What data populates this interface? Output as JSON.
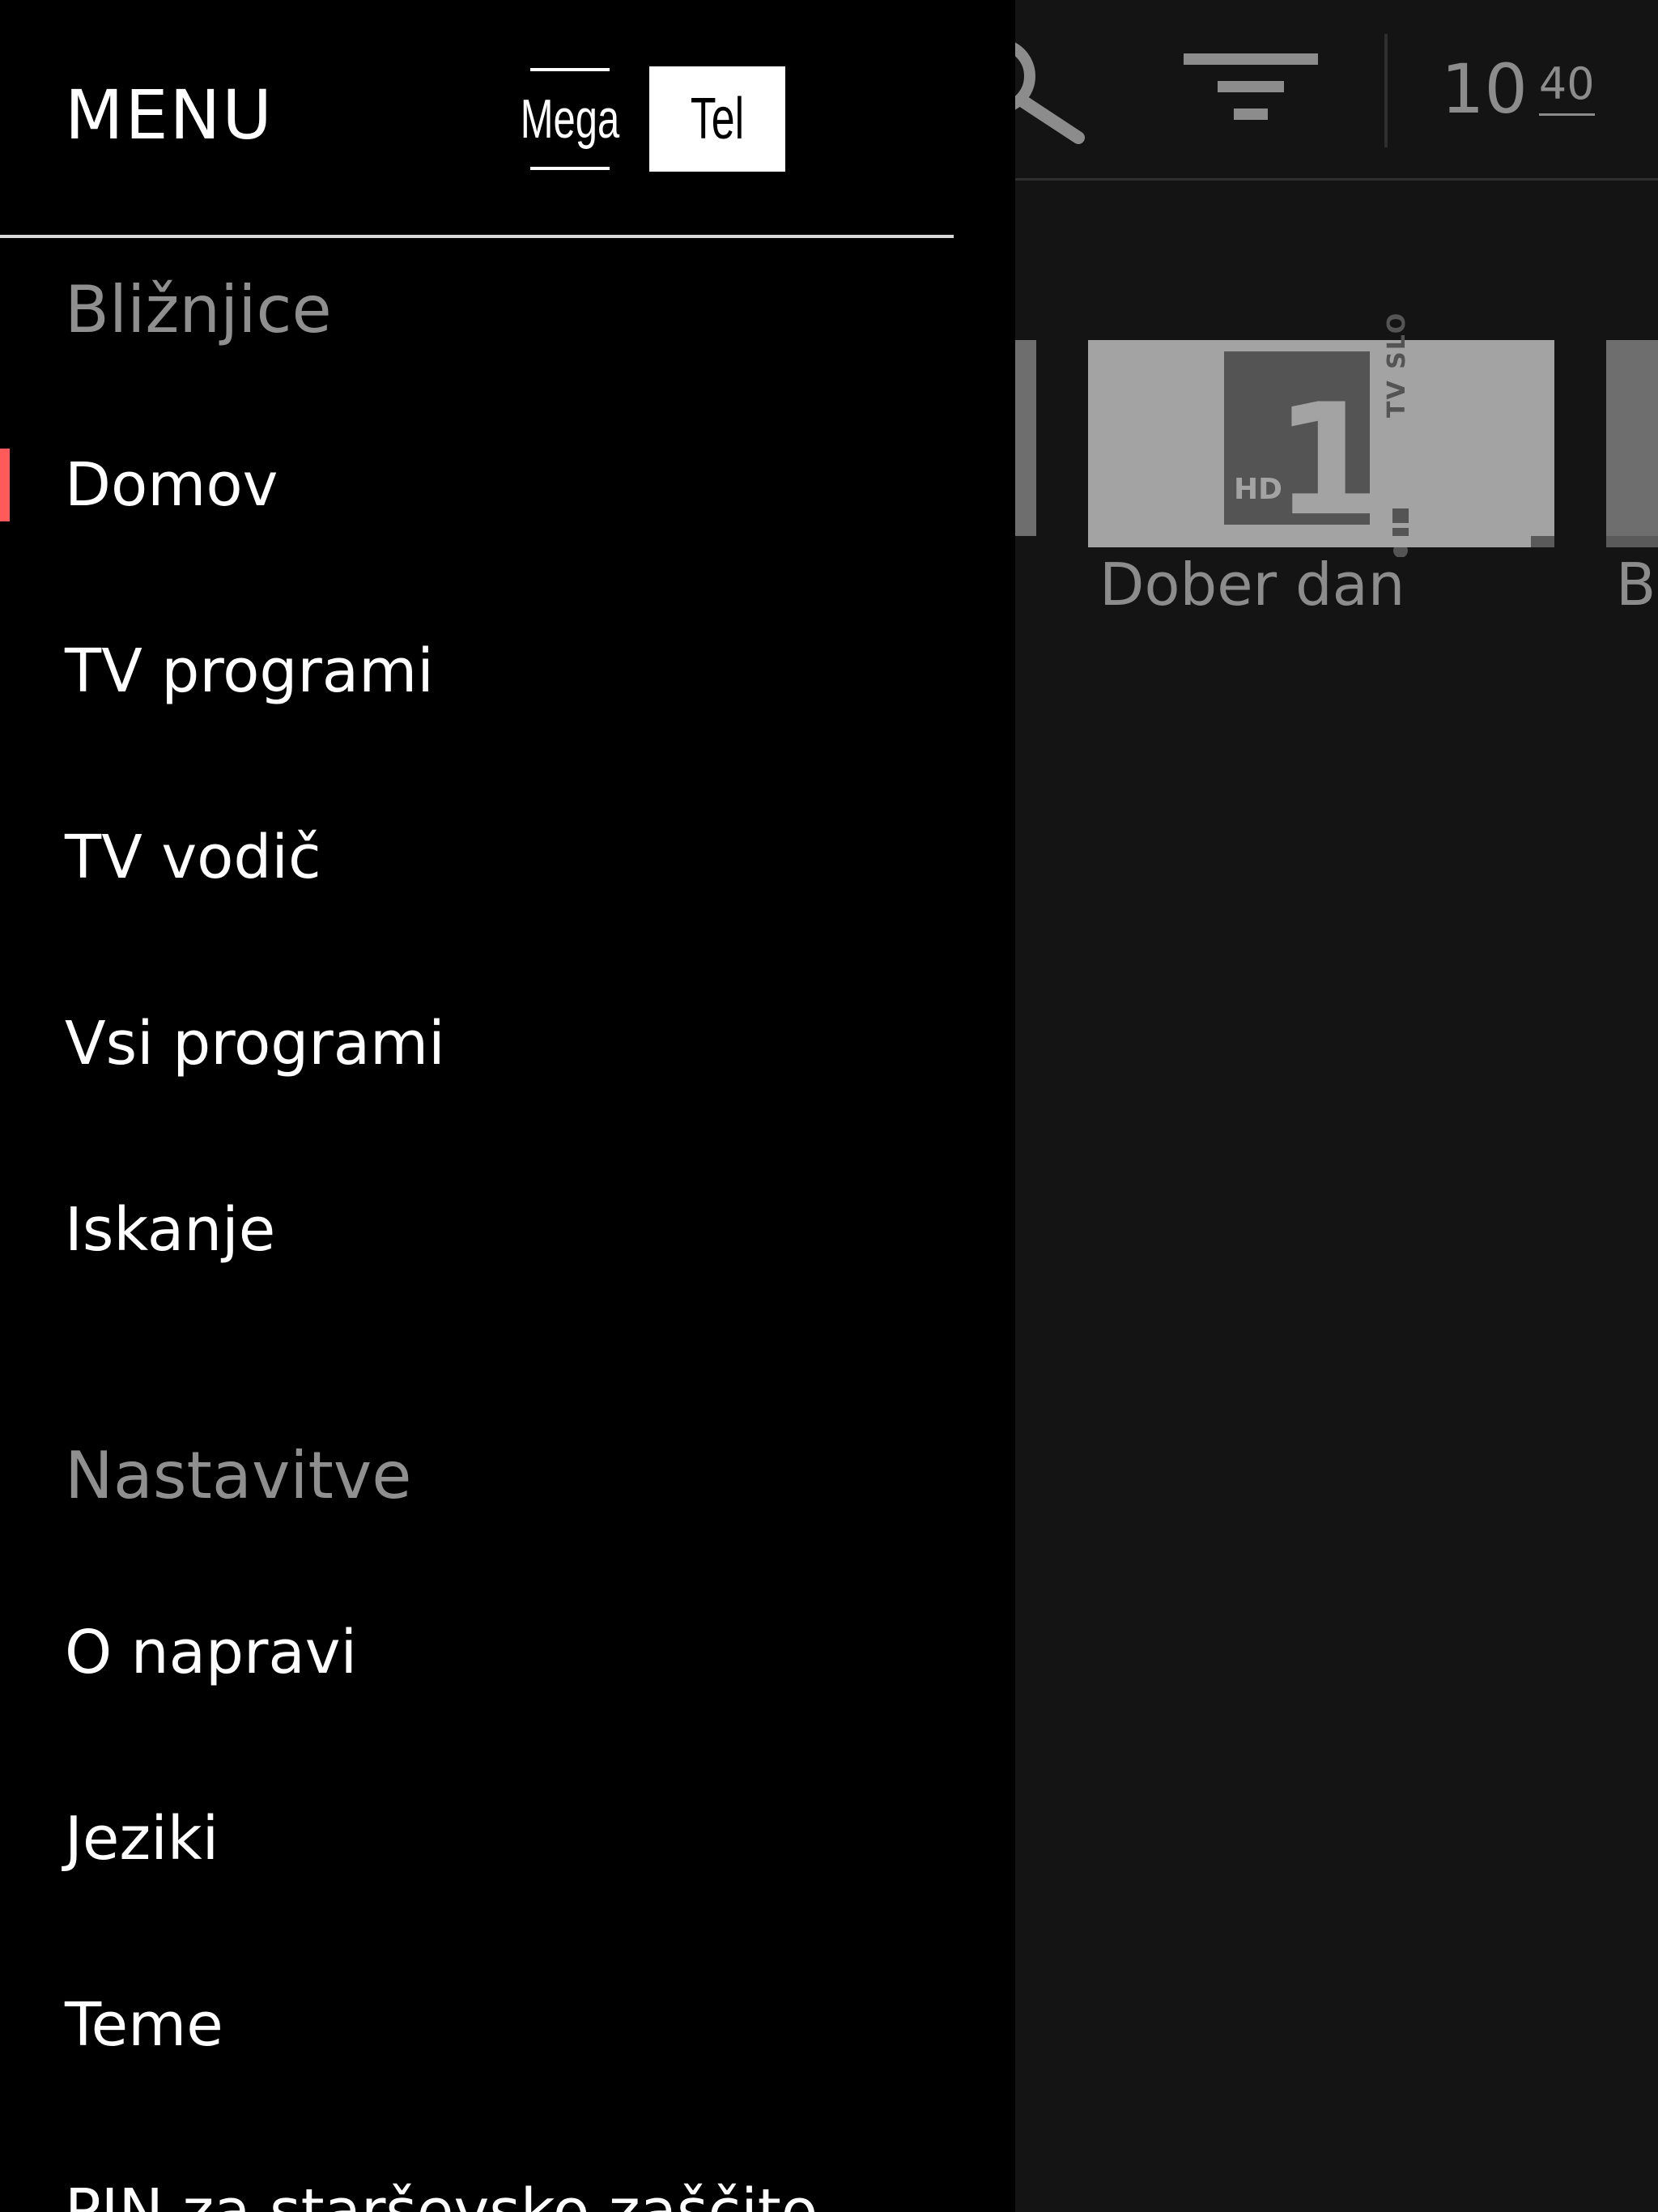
{
  "colors": {
    "active_indicator": "#ff5a5a",
    "drawer_bg": "#000000",
    "screen_bg": "#141414"
  },
  "header": {
    "search_icon": "search-icon",
    "filter_icon": "filter-icon",
    "clock_hours": "10",
    "clock_minutes": "40"
  },
  "content": {
    "tile": {
      "channel_badge": "HD",
      "channel_number": "1",
      "channel_brand": "TV SLO",
      "title": "Dober dan",
      "progress": 0.95
    },
    "next_tile_title": "B"
  },
  "drawer": {
    "title": "MENU",
    "brand": {
      "part1": "Mega",
      "part2": "Tel"
    },
    "sections": [
      {
        "label": "Bližnjice",
        "items": [
          {
            "label": "Domov",
            "active": true
          },
          {
            "label": "TV programi",
            "active": false
          },
          {
            "label": "TV vodič",
            "active": false
          },
          {
            "label": "Vsi programi",
            "active": false
          },
          {
            "label": "Iskanje",
            "active": false
          }
        ]
      },
      {
        "label": "Nastavitve",
        "items": [
          {
            "label": "O napravi",
            "active": false
          },
          {
            "label": "Jeziki",
            "active": false
          },
          {
            "label": "Teme",
            "active": false
          },
          {
            "label": "PIN za starševsko zaščito",
            "active": false
          }
        ]
      }
    ]
  }
}
